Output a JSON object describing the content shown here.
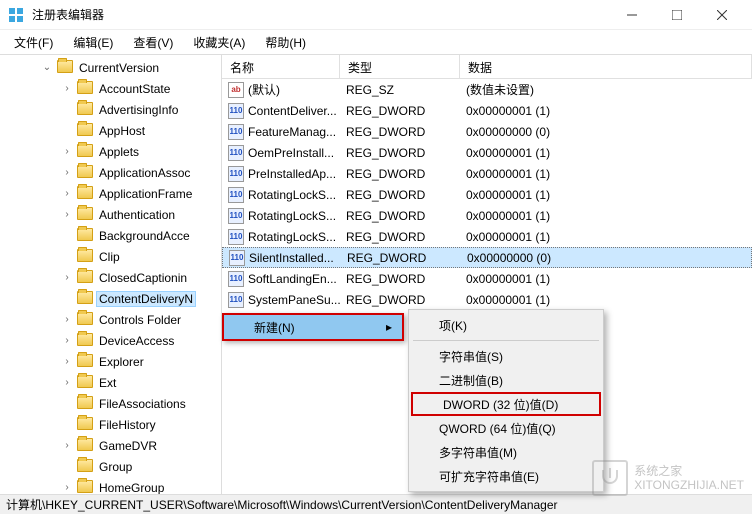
{
  "window": {
    "title": "注册表编辑器"
  },
  "menu": {
    "file": "文件(F)",
    "edit": "编辑(E)",
    "view": "查看(V)",
    "favorites": "收藏夹(A)",
    "help": "帮助(H)"
  },
  "tree": {
    "root": "CurrentVersion",
    "items": [
      "AccountState",
      "AdvertisingInfo",
      "AppHost",
      "Applets",
      "ApplicationAssoc",
      "ApplicationFrame",
      "Authentication",
      "BackgroundAcce",
      "Clip",
      "ClosedCaptionin",
      "ContentDeliveryN",
      "Controls Folder",
      "DeviceAccess",
      "Explorer",
      "Ext",
      "FileAssociations",
      "FileHistory",
      "GameDVR",
      "Group",
      "HomeGroup"
    ],
    "selected_index": 10,
    "expandable_indices": [
      0,
      3,
      4,
      5,
      6,
      9,
      11,
      12,
      13,
      14,
      17,
      19
    ]
  },
  "list": {
    "headers": {
      "name": "名称",
      "type": "类型",
      "data": "数据"
    },
    "rows": [
      {
        "icon": "sz",
        "name": "(默认)",
        "type": "REG_SZ",
        "data": "(数值未设置)"
      },
      {
        "icon": "dw",
        "name": "ContentDeliver...",
        "type": "REG_DWORD",
        "data": "0x00000001 (1)"
      },
      {
        "icon": "dw",
        "name": "FeatureManag...",
        "type": "REG_DWORD",
        "data": "0x00000000 (0)"
      },
      {
        "icon": "dw",
        "name": "OemPreInstall...",
        "type": "REG_DWORD",
        "data": "0x00000001 (1)"
      },
      {
        "icon": "dw",
        "name": "PreInstalledAp...",
        "type": "REG_DWORD",
        "data": "0x00000001 (1)"
      },
      {
        "icon": "dw",
        "name": "RotatingLockS...",
        "type": "REG_DWORD",
        "data": "0x00000001 (1)"
      },
      {
        "icon": "dw",
        "name": "RotatingLockS...",
        "type": "REG_DWORD",
        "data": "0x00000001 (1)"
      },
      {
        "icon": "dw",
        "name": "RotatingLockS...",
        "type": "REG_DWORD",
        "data": "0x00000001 (1)"
      },
      {
        "icon": "dw",
        "name": "SilentInstalled...",
        "type": "REG_DWORD",
        "data": "0x00000000 (0)"
      },
      {
        "icon": "dw",
        "name": "SoftLandingEn...",
        "type": "REG_DWORD",
        "data": "0x00000001 (1)"
      },
      {
        "icon": "dw",
        "name": "SystemPaneSu...",
        "type": "REG_DWORD",
        "data": "0x00000001 (1)"
      }
    ],
    "selected_index": 8
  },
  "context": {
    "new_label": "新建(N)",
    "submenu": [
      "项(K)",
      "字符串值(S)",
      "二进制值(B)",
      "DWORD (32 位)值(D)",
      "QWORD (64 位)值(Q)",
      "多字符串值(M)",
      "可扩充字符串值(E)"
    ],
    "highlighted_index": 3
  },
  "statusbar": {
    "path": "计算机\\HKEY_CURRENT_USER\\Software\\Microsoft\\Windows\\CurrentVersion\\ContentDeliveryManager"
  },
  "watermark": {
    "line1": "系统之家",
    "line2": "XITONGZHIJIA.NET"
  }
}
